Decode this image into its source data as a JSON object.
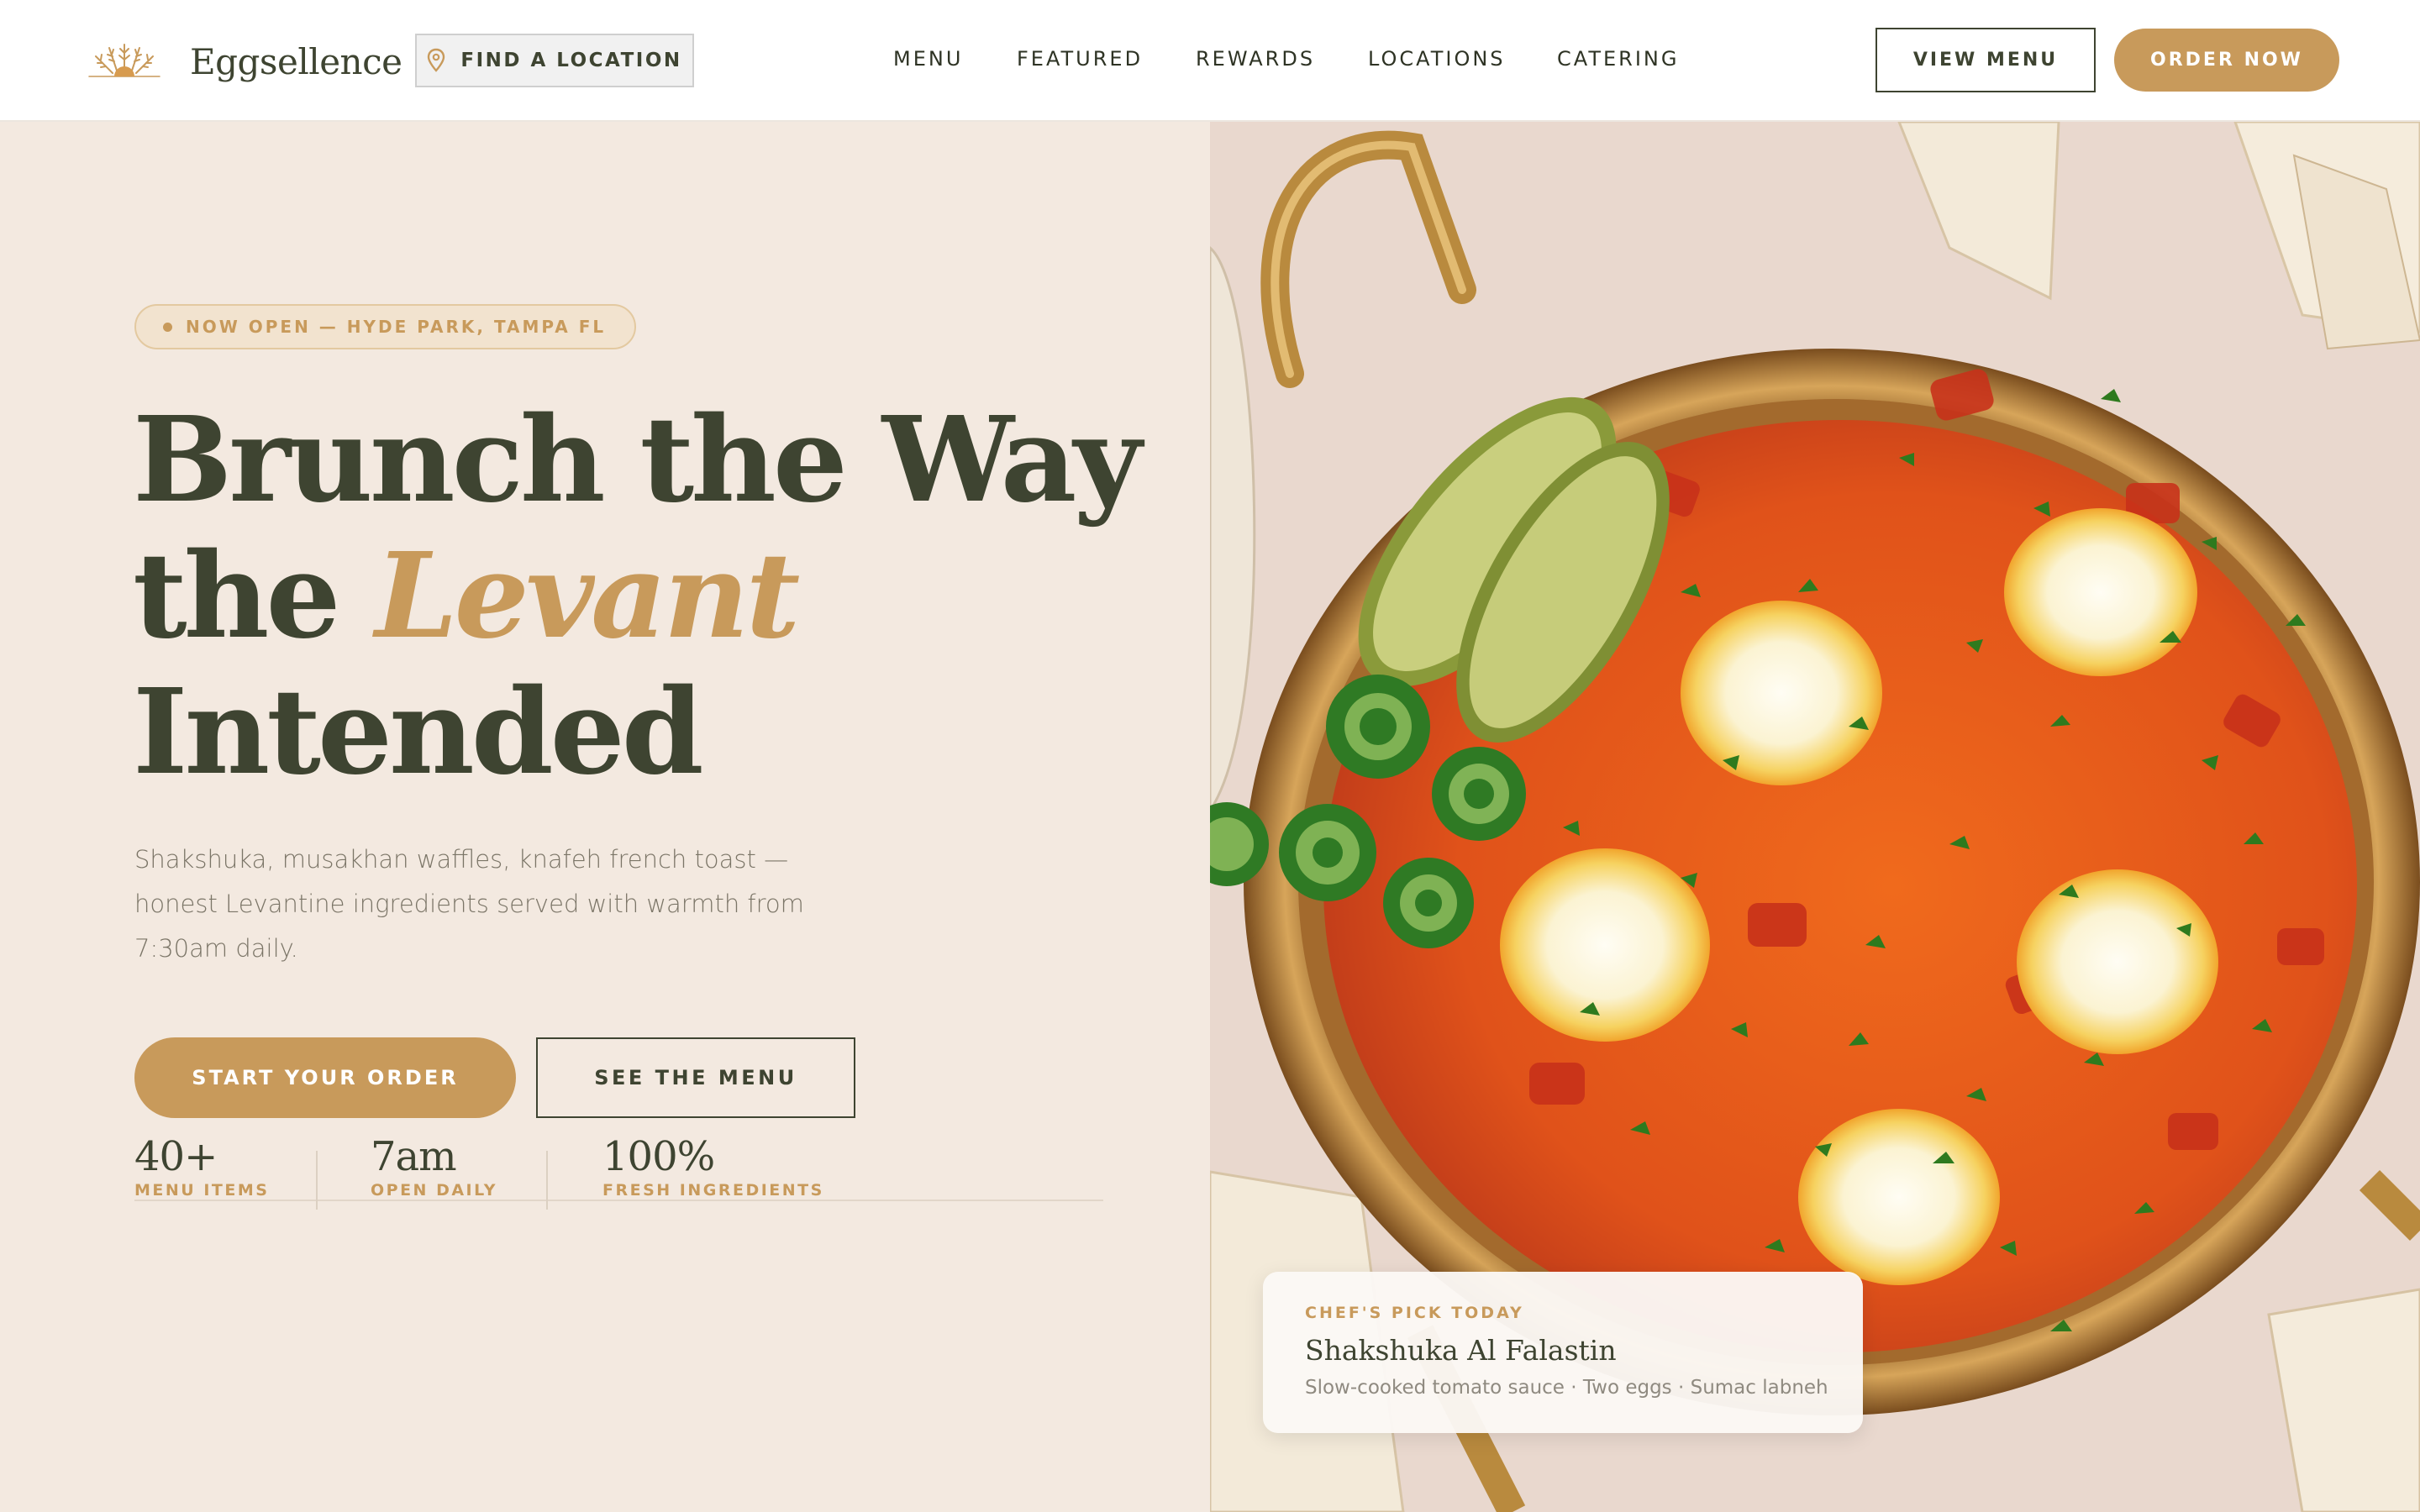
{
  "brand": {
    "name": "Eggsellence",
    "logo_icon": "sunrise-wheat-logo",
    "accent_color": "#c89a5b",
    "ink_color": "#3e4431"
  },
  "header": {
    "find_location": {
      "label": "FIND A LOCATION",
      "icon": "map-pin-icon"
    },
    "nav": [
      "MENU",
      "FEATURED",
      "REWARDS",
      "LOCATIONS",
      "CATERING"
    ],
    "view_menu_label": "VIEW MENU",
    "order_now_label": "ORDER NOW"
  },
  "hero": {
    "badge": "NOW OPEN — HYDE PARK, TAMPA FL",
    "headline": {
      "line1": "Brunch the Way",
      "line2_prefix": "the ",
      "line2_accent": "Levant",
      "line3": "Intended"
    },
    "lede": "Shakshuka, musakhan waffles, knafeh french toast — honest Levantine ingredients served with warmth from 7:30am daily.",
    "primary_cta": "START YOUR ORDER",
    "secondary_cta": "SEE THE MENU",
    "stats": [
      {
        "value": "40+",
        "label": "MENU ITEMS"
      },
      {
        "value": "7am",
        "label": "OPEN DAILY"
      },
      {
        "value": "100%",
        "label": "FRESH INGREDIENTS"
      }
    ]
  },
  "chef_pick": {
    "kicker": "CHEF'S PICK TODAY",
    "name": "Shakshuka Al Falastin",
    "description": "Slow-cooked tomato sauce · Two eggs · Sumac labneh"
  }
}
